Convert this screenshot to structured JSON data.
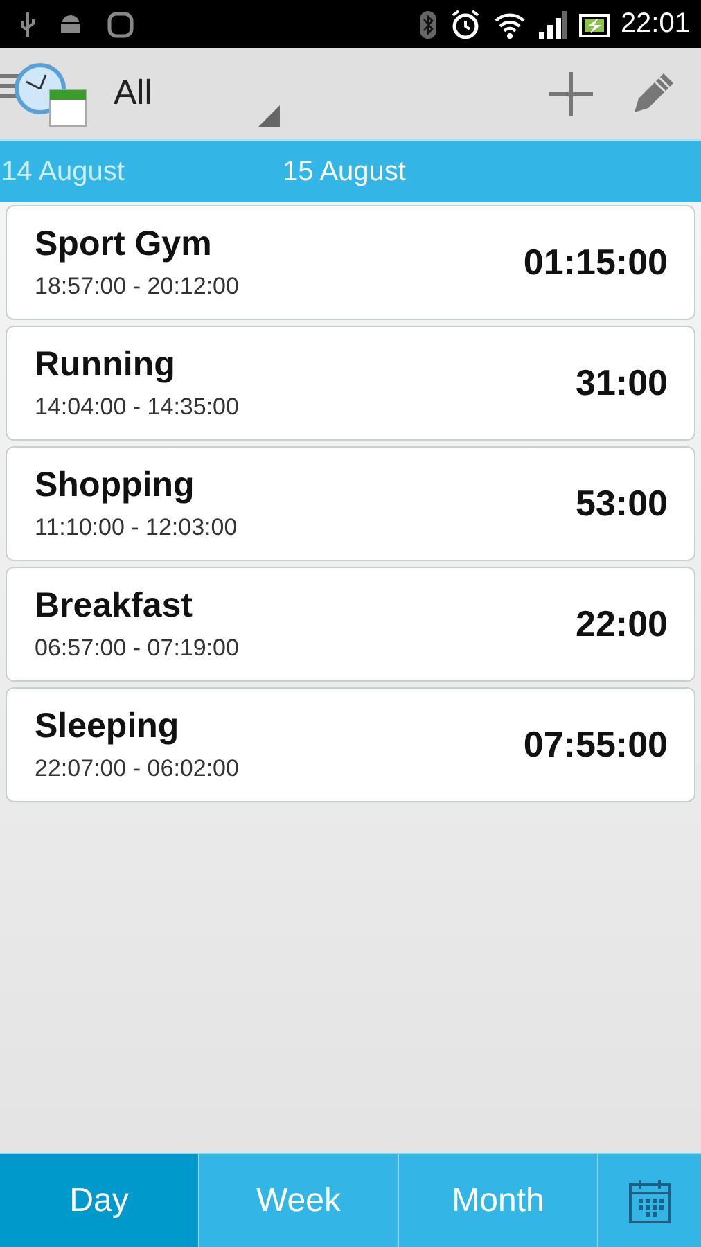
{
  "status_bar": {
    "time": "22:01"
  },
  "toolbar": {
    "filter": "All"
  },
  "dates": [
    {
      "label": "14 August",
      "selected": false
    },
    {
      "label": "15 August",
      "selected": true
    }
  ],
  "entries": [
    {
      "name": "Sport Gym",
      "range": "18:57:00 - 20:12:00",
      "duration": "01:15:00"
    },
    {
      "name": "Running",
      "range": "14:04:00 - 14:35:00",
      "duration": "31:00"
    },
    {
      "name": "Shopping",
      "range": "11:10:00 - 12:03:00",
      "duration": "53:00"
    },
    {
      "name": "Breakfast",
      "range": "06:57:00 - 07:19:00",
      "duration": "22:00"
    },
    {
      "name": "Sleeping",
      "range": "22:07:00 - 06:02:00",
      "duration": "07:55:00"
    }
  ],
  "tabs": [
    {
      "label": "Day",
      "selected": true
    },
    {
      "label": "Week",
      "selected": false
    },
    {
      "label": "Month",
      "selected": false
    }
  ]
}
